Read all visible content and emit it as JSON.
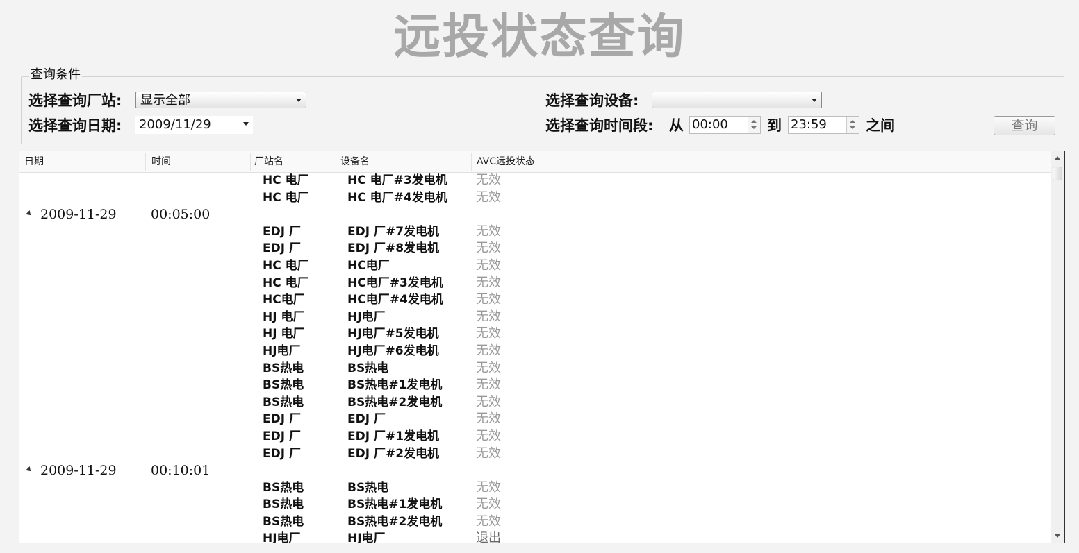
{
  "title": "远投状态查询",
  "query": {
    "group_label": "查询条件",
    "station_label": "选择查询厂站:",
    "station_value": "显示全部",
    "device_label": "选择查询设备:",
    "device_value": "",
    "date_label": "选择查询日期:",
    "date_value": "2009/11/29",
    "period_label": "选择查询时间段:",
    "from_label": "从",
    "from_value": "00:00",
    "to_label": "到",
    "to_value": "23:59",
    "between_label": "之间",
    "query_button": "查询"
  },
  "grid": {
    "columns": [
      "日期",
      "时间",
      "厂站名",
      "设备名",
      "AVC远投状态"
    ],
    "rows": [
      {
        "type": "item",
        "station": "HC 电厂",
        "device": "HC 电厂#3发电机",
        "status": "无效"
      },
      {
        "type": "item",
        "station": "HC 电厂",
        "device": "HC 电厂#4发电机",
        "status": "无效"
      },
      {
        "type": "group",
        "date": "2009-11-29",
        "time": "00:05:00"
      },
      {
        "type": "item",
        "station": "EDJ 厂",
        "device": "EDJ 厂#7发电机",
        "status": "无效"
      },
      {
        "type": "item",
        "station": "EDJ 厂",
        "device": "EDJ 厂#8发电机",
        "status": "无效"
      },
      {
        "type": "item",
        "station": "HC 电厂",
        "device": "HC电厂",
        "status": "无效"
      },
      {
        "type": "item",
        "station": "HC 电厂",
        "device": "HC电厂#3发电机",
        "status": "无效"
      },
      {
        "type": "item",
        "station": "HC电厂",
        "device": "HC电厂#4发电机",
        "status": "无效"
      },
      {
        "type": "item",
        "station": "HJ 电厂",
        "device": "HJ电厂",
        "status": "无效"
      },
      {
        "type": "item",
        "station": "HJ 电厂",
        "device": "HJ电厂#5发电机",
        "status": "无效"
      },
      {
        "type": "item",
        "station": "HJ电厂",
        "device": "HJ电厂#6发电机",
        "status": "无效"
      },
      {
        "type": "item",
        "station": "BS热电",
        "device": "BS热电",
        "status": "无效"
      },
      {
        "type": "item",
        "station": "BS热电",
        "device": "BS热电#1发电机",
        "status": "无效"
      },
      {
        "type": "item",
        "station": "BS热电",
        "device": "BS热电#2发电机",
        "status": "无效"
      },
      {
        "type": "item",
        "station": "EDJ 厂",
        "device": "EDJ 厂",
        "status": "无效"
      },
      {
        "type": "item",
        "station": "EDJ 厂",
        "device": "EDJ 厂#1发电机",
        "status": "无效"
      },
      {
        "type": "item",
        "station": "EDJ 厂",
        "device": "EDJ 厂#2发电机",
        "status": "无效"
      },
      {
        "type": "group",
        "date": "2009-11-29",
        "time": "00:10:01"
      },
      {
        "type": "item",
        "station": "BS热电",
        "device": "BS热电",
        "status": "无效"
      },
      {
        "type": "item",
        "station": "BS热电",
        "device": "BS热电#1发电机",
        "status": "无效"
      },
      {
        "type": "item",
        "station": "BS热电",
        "device": "BS热电#2发电机",
        "status": "无效"
      },
      {
        "type": "item",
        "station": "HJ电厂",
        "device": "HJ电厂",
        "status": "退出"
      }
    ]
  }
}
